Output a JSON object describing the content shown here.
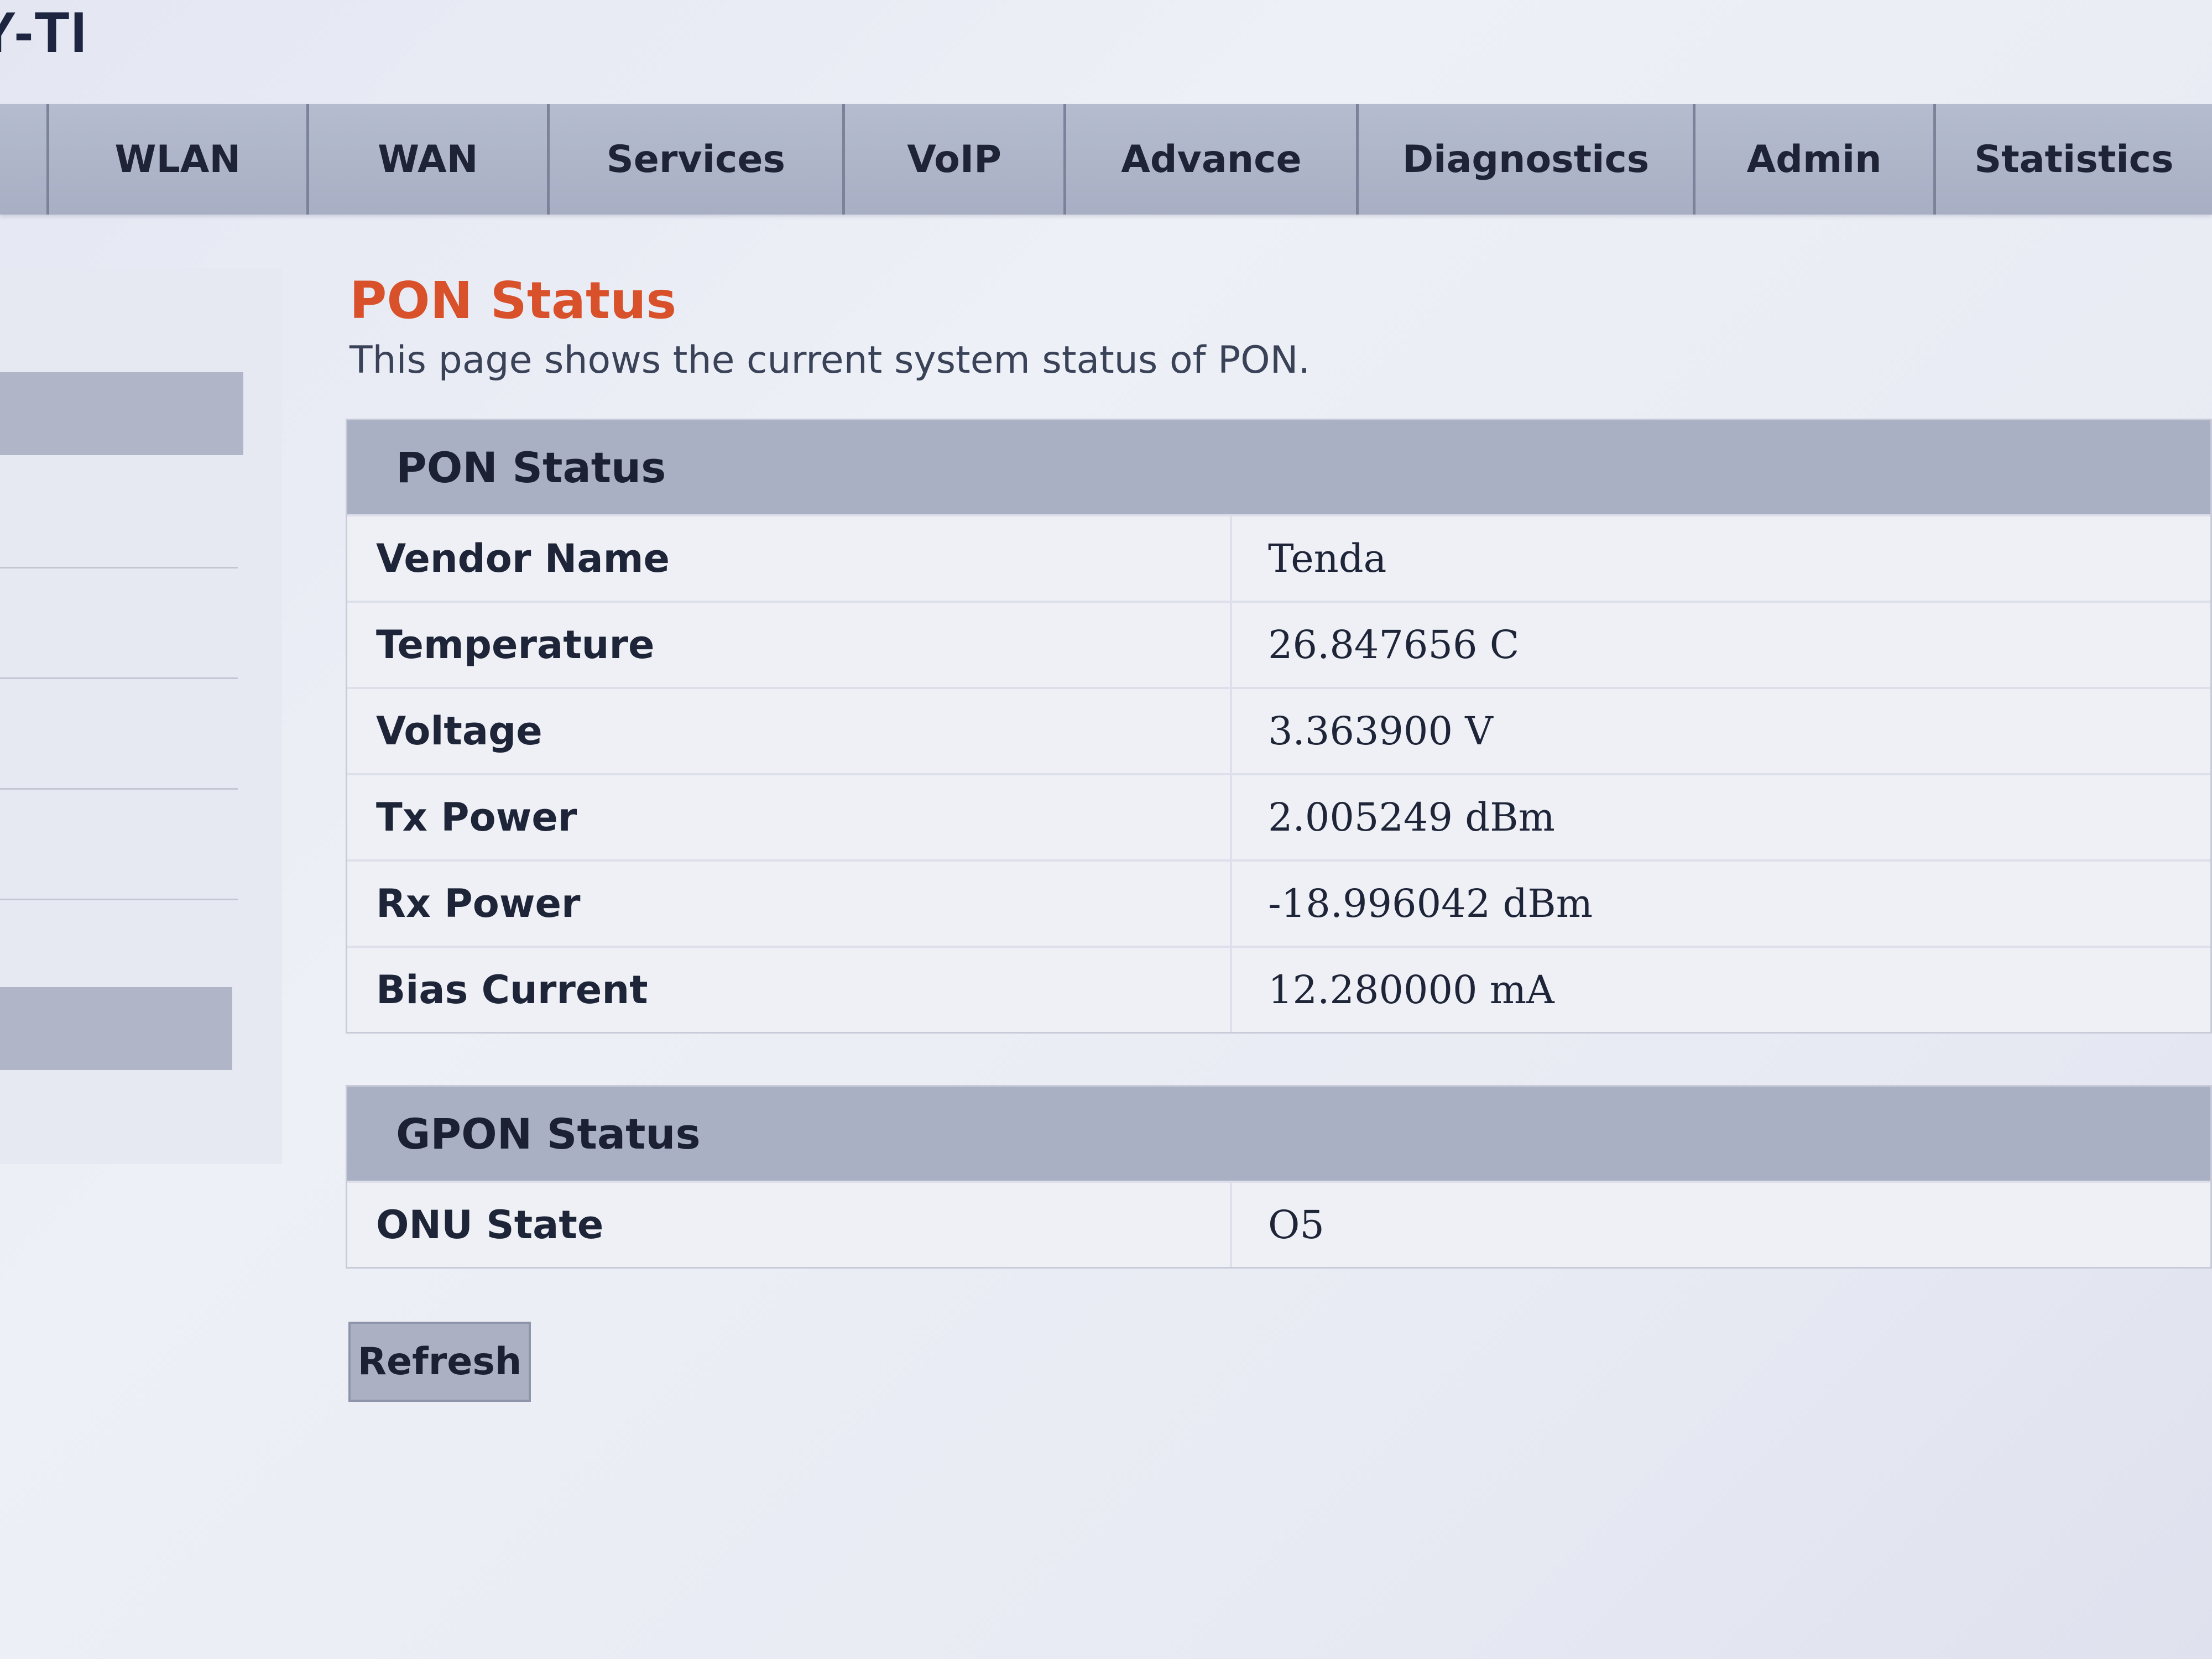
{
  "brand": {
    "logo_text": "Y-TI"
  },
  "nav": {
    "items": [
      {
        "label": "WLAN"
      },
      {
        "label": "WAN"
      },
      {
        "label": "Services"
      },
      {
        "label": "VoIP"
      },
      {
        "label": "Advance"
      },
      {
        "label": "Diagnostics"
      },
      {
        "label": "Admin"
      },
      {
        "label": "Statistics"
      }
    ]
  },
  "main": {
    "title": "PON Status",
    "description": "This page shows the current system status of PON.",
    "pon_panel": {
      "header": "PON Status",
      "rows": [
        {
          "label": "Vendor Name",
          "value": "Tenda"
        },
        {
          "label": "Temperature",
          "value": "26.847656 C"
        },
        {
          "label": "Voltage",
          "value": "3.363900 V"
        },
        {
          "label": "Tx Power",
          "value": "2.005249 dBm"
        },
        {
          "label": "Rx Power",
          "value": "-18.996042 dBm"
        },
        {
          "label": "Bias Current",
          "value": "12.280000 mA"
        }
      ]
    },
    "gpon_panel": {
      "header": "GPON Status",
      "rows": [
        {
          "label": "ONU State",
          "value": "O5"
        }
      ]
    },
    "refresh_label": "Refresh"
  }
}
